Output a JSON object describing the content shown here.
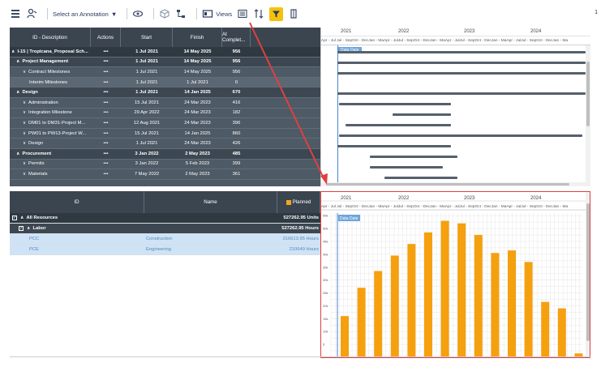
{
  "toolbar": {
    "annotation_label": "Select an Annotation",
    "views_label": "Views",
    "page_indicator": "1"
  },
  "top_grid": {
    "columns": [
      "ID - Description",
      "Actions",
      "Start",
      "Finish",
      "At Complet..."
    ],
    "rows": [
      {
        "label": "I-15 | Tropicana_Proposal Sch...",
        "actions": "•••",
        "start": "1 Jul 2021",
        "finish": "14 May 2025",
        "at": "956",
        "level": 0,
        "chevron": "^"
      },
      {
        "label": "Project Management",
        "actions": "•••",
        "start": "1 Jul 2021",
        "finish": "14 May 2025",
        "at": "956",
        "level": 1,
        "chevron": "^"
      },
      {
        "label": "Contract Milestones",
        "actions": "•••",
        "start": "1 Jul 2021",
        "finish": "14 May 2025",
        "at": "956",
        "level": 2,
        "chevron": "v"
      },
      {
        "label": "Interim Milestones",
        "actions": "•••",
        "start": "1 Jul 2021",
        "finish": "1 Jul 2021",
        "at": "0",
        "level": 3,
        "chevron": ""
      },
      {
        "label": "Design",
        "actions": "•••",
        "start": "1 Jul 2021",
        "finish": "14 Jan 2025",
        "at": "670",
        "level": 1,
        "chevron": "^"
      },
      {
        "label": "Administration",
        "actions": "•••",
        "start": "15 Jul 2021",
        "finish": "24 Mar 2023",
        "at": "416",
        "level": 2,
        "chevron": "v"
      },
      {
        "label": "Integration Milestone",
        "actions": "•••",
        "start": "29 Apr 2022",
        "finish": "24 Mar 2023",
        "at": "182",
        "level": 2,
        "chevron": "v"
      },
      {
        "label": "DM01 to DM31-Project M...",
        "actions": "•••",
        "start": "12 Aug 2021",
        "finish": "24 Mar 2023",
        "at": "396",
        "level": 2,
        "chevron": "v"
      },
      {
        "label": "PW01 to PW13-Project W...",
        "actions": "•••",
        "start": "15 Jul 2021",
        "finish": "14 Jan 2025",
        "at": "860",
        "level": 2,
        "chevron": "v"
      },
      {
        "label": "Design",
        "actions": "•••",
        "start": "1 Jul 2021",
        "finish": "24 Mar 2023",
        "at": "426",
        "level": 2,
        "chevron": "v"
      },
      {
        "label": "Procurement",
        "actions": "•••",
        "start": "3 Jan 2022",
        "finish": "2 May 2023",
        "at": "485",
        "level": 1,
        "chevron": "^"
      },
      {
        "label": "Permits",
        "actions": "•••",
        "start": "3 Jan 2022",
        "finish": "5 Feb 2023",
        "at": "399",
        "level": 2,
        "chevron": "v"
      },
      {
        "label": "Materials",
        "actions": "•••",
        "start": "7 May 2022",
        "finish": "2 May 2023",
        "at": "361",
        "level": 2,
        "chevron": "v"
      }
    ]
  },
  "timeline": {
    "years": [
      "2021",
      "2022",
      "2023",
      "2024"
    ],
    "months": "Apr - Jul Jul - SepOct - DecJan - MaApr - JulJul - SepOct - DecJan - MaApr - JulJul - SepOct - DecJan - MaApr - JulJul - SepOct - DecJan - Ma"
  },
  "gantt": {
    "data_date_label": "Data Date"
  },
  "bottom_grid": {
    "columns": [
      "ID",
      "Name",
      "Planned"
    ],
    "rows": [
      {
        "id": "All Resources",
        "name": "",
        "planned": "527262.95 Units",
        "style": "dark",
        "checkbox": "✓",
        "chevron": "^"
      },
      {
        "id": "Labor",
        "name": "",
        "planned": "527262.95 Hours",
        "style": "mid",
        "checkbox": "✓",
        "chevron": "^"
      },
      {
        "id": "PCC",
        "name": "Construction",
        "planned": "316613.95 Hours",
        "style": "sel",
        "checkbox": "",
        "chevron": ""
      },
      {
        "id": "PCE",
        "name": "Engineering",
        "planned": "210649 Hours",
        "style": "sel",
        "checkbox": "",
        "chevron": ""
      }
    ]
  },
  "chart_data": {
    "type": "bar",
    "title": "",
    "xlabel": "",
    "ylabel": "",
    "year_labels": [
      "2021",
      "2022",
      "2023",
      "2024"
    ],
    "data_date_label": "Data Date",
    "y_ticks": [
      "5",
      "10k",
      "15k",
      "20k",
      "25k",
      "30k",
      "35k",
      "40k",
      "45k",
      "50k",
      "55k"
    ],
    "ylim": [
      0,
      56000
    ],
    "values": [
      16000,
      27000,
      33500,
      39500,
      44000,
      48500,
      53000,
      52000,
      47500,
      40500,
      41500,
      37000,
      21500,
      19000,
      1500
    ],
    "bar_color": "#f5a00f",
    "grid": true
  },
  "colors": {
    "grid_header": "#3b4550",
    "highlight_border": "#e04040",
    "bar": "#f5a00f",
    "filter_button": "#f4c20d"
  }
}
